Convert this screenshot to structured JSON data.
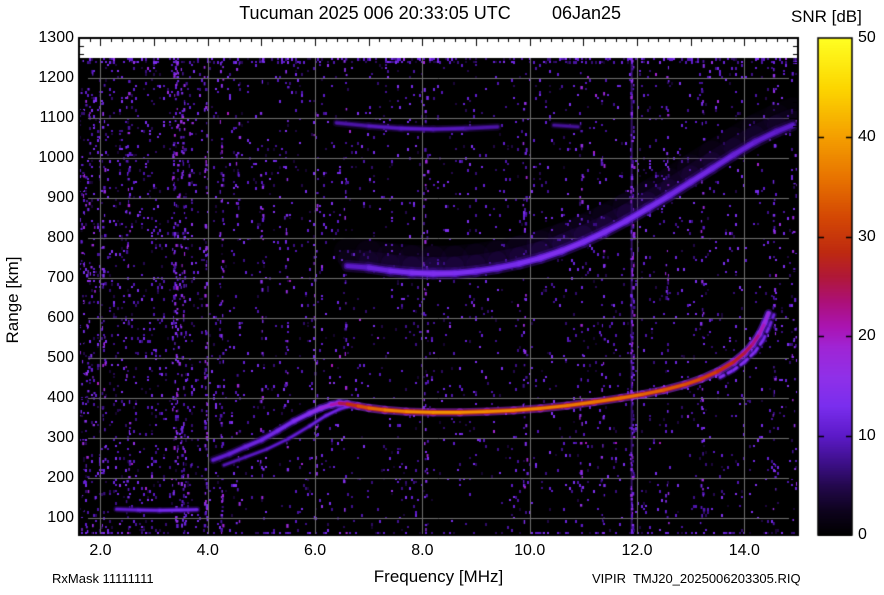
{
  "header": {
    "title": "Tucuman 2025 006 20:33:05 UTC",
    "date": "06Jan25"
  },
  "footer": {
    "left": "RxMask 11111111",
    "right": "VIPIR  TMJ20_2025006203305.RIQ"
  },
  "colorbar": {
    "title": "SNR [dB]",
    "min": 0,
    "max": 50,
    "tick_values": [
      0,
      10,
      20,
      30,
      40,
      50
    ],
    "tick_labels": [
      "0",
      "10",
      "20",
      "30",
      "40",
      "50"
    ]
  },
  "chart_data": {
    "type": "heatmap",
    "title": "Tucuman 2025 006 20:33:05 UTC 06Jan25",
    "xlabel": "Frequency [MHz]",
    "ylabel": "Range [km]",
    "zlabel": "SNR [dB]",
    "xlim": [
      1.6,
      15.0
    ],
    "ylim": [
      57.5,
      1300
    ],
    "zlim": [
      0,
      50
    ],
    "grid": true,
    "grid_color": "#6f6f6f",
    "x_major_ticks": [
      2,
      4,
      6,
      8,
      10,
      12,
      14
    ],
    "x_tick_labels": [
      "2.0",
      "4.0",
      "6.0",
      "8.0",
      "10.0",
      "12.0",
      "14.0"
    ],
    "x_minor_step": 0.2,
    "y_major_ticks": [
      100,
      200,
      300,
      400,
      500,
      600,
      700,
      800,
      900,
      1000,
      1100,
      1200,
      1300
    ],
    "y_minor_step": 20,
    "data_region_range_km": [
      60,
      1250
    ],
    "background_color": "#000000",
    "colormap_stops": [
      [
        0.0,
        [
          0,
          0,
          0
        ]
      ],
      [
        0.05,
        [
          14,
          3,
          30
        ]
      ],
      [
        0.1,
        [
          36,
          8,
          78
        ]
      ],
      [
        0.14,
        [
          58,
          14,
          130
        ]
      ],
      [
        0.2,
        [
          92,
          26,
          200
        ]
      ],
      [
        0.26,
        [
          122,
          46,
          238
        ]
      ],
      [
        0.32,
        [
          144,
          48,
          232
        ]
      ],
      [
        0.38,
        [
          160,
          36,
          212
        ]
      ],
      [
        0.42,
        [
          170,
          20,
          178
        ]
      ],
      [
        0.47,
        [
          172,
          16,
          120
        ]
      ],
      [
        0.52,
        [
          176,
          24,
          56
        ]
      ],
      [
        0.57,
        [
          190,
          42,
          16
        ]
      ],
      [
        0.64,
        [
          212,
          72,
          4
        ]
      ],
      [
        0.72,
        [
          232,
          116,
          0
        ]
      ],
      [
        0.8,
        [
          244,
          158,
          0
        ]
      ],
      [
        0.9,
        [
          252,
          214,
          0
        ]
      ],
      [
        1.0,
        [
          255,
          255,
          34
        ]
      ]
    ],
    "traces": {
      "f2_o_mode": {
        "label": "F2 first-hop O-mode echo",
        "base_width": 3.2,
        "points": [
          [
            4.1,
            245,
            10
          ],
          [
            4.4,
            260,
            11
          ],
          [
            4.7,
            278,
            11
          ],
          [
            5.0,
            295,
            12
          ],
          [
            5.3,
            318,
            12
          ],
          [
            5.6,
            342,
            13
          ],
          [
            5.9,
            362,
            15
          ],
          [
            6.1,
            374,
            16
          ],
          [
            6.3,
            383,
            19
          ],
          [
            6.45,
            387,
            23
          ],
          [
            6.6,
            385,
            27
          ],
          [
            6.8,
            380,
            31
          ],
          [
            7.0,
            375,
            34
          ],
          [
            7.3,
            370,
            36
          ],
          [
            7.7,
            366,
            38
          ],
          [
            8.2,
            364,
            39
          ],
          [
            8.7,
            364,
            39
          ],
          [
            9.2,
            366,
            38
          ],
          [
            9.7,
            369,
            38
          ],
          [
            10.2,
            374,
            37
          ],
          [
            10.7,
            381,
            37
          ],
          [
            11.2,
            390,
            36
          ],
          [
            11.7,
            400,
            36
          ],
          [
            12.1,
            409,
            35
          ],
          [
            12.5,
            420,
            34
          ],
          [
            12.9,
            434,
            33
          ],
          [
            13.2,
            448,
            32
          ],
          [
            13.5,
            466,
            30
          ],
          [
            13.8,
            490,
            28
          ],
          [
            14.0,
            512,
            26
          ],
          [
            14.15,
            534,
            24
          ],
          [
            14.28,
            560,
            22
          ],
          [
            14.38,
            588,
            19
          ],
          [
            14.45,
            612,
            16
          ]
        ]
      },
      "f2_x_mode_rise": {
        "label": "F2 X-mode rising branch",
        "base_width": 2.2,
        "points": [
          [
            4.3,
            232,
            9
          ],
          [
            4.7,
            252,
            9
          ],
          [
            5.1,
            272,
            10
          ],
          [
            5.5,
            298,
            10
          ],
          [
            5.9,
            330,
            11
          ],
          [
            6.2,
            356,
            12
          ],
          [
            6.45,
            372,
            12
          ],
          [
            6.6,
            378,
            11
          ]
        ]
      },
      "f2_x_mode_tail": {
        "label": "F2 X-mode cusp",
        "base_width": 2.4,
        "dashed": true,
        "points": [
          [
            13.55,
            452,
            14
          ],
          [
            13.8,
            470,
            14
          ],
          [
            14.0,
            490,
            14
          ],
          [
            14.2,
            516,
            14
          ],
          [
            14.35,
            545,
            13
          ],
          [
            14.47,
            580,
            12
          ],
          [
            14.55,
            608,
            11
          ]
        ]
      },
      "second_hop": {
        "label": "Second-hop / spread F echo",
        "base_width": 4.6,
        "haze": true,
        "points": [
          [
            6.6,
            730,
            9
          ],
          [
            7.0,
            726,
            11
          ],
          [
            7.4,
            718,
            12
          ],
          [
            7.8,
            713,
            13
          ],
          [
            8.2,
            711,
            14
          ],
          [
            8.6,
            712,
            13
          ],
          [
            9.0,
            717,
            13
          ],
          [
            9.4,
            725,
            12
          ],
          [
            9.8,
            736,
            13
          ],
          [
            10.2,
            750,
            13
          ],
          [
            10.6,
            768,
            14
          ],
          [
            11.0,
            790,
            13
          ],
          [
            11.4,
            815,
            13
          ],
          [
            11.8,
            843,
            13
          ],
          [
            12.2,
            874,
            13
          ],
          [
            12.6,
            906,
            12
          ],
          [
            13.0,
            940,
            12
          ],
          [
            13.4,
            974,
            12
          ],
          [
            13.8,
            1008,
            11
          ],
          [
            14.2,
            1040,
            11
          ],
          [
            14.6,
            1066,
            10
          ],
          [
            14.9,
            1082,
            10
          ]
        ]
      },
      "upper_arc": {
        "label": "Faint multi-hop arc",
        "base_width": 3.0,
        "points": [
          [
            6.4,
            1088,
            8
          ],
          [
            7.0,
            1080,
            9
          ],
          [
            7.6,
            1074,
            10
          ],
          [
            8.2,
            1072,
            10
          ],
          [
            8.8,
            1074,
            9
          ],
          [
            9.4,
            1078,
            8
          ]
        ]
      },
      "upper_arc2": {
        "label": "Faint multi-hop arc segment",
        "base_width": 2.6,
        "points": [
          [
            10.45,
            1082,
            8
          ],
          [
            10.9,
            1078,
            8
          ]
        ]
      },
      "e_region": {
        "label": "E-region echo",
        "base_width": 2.5,
        "points": [
          [
            2.3,
            122,
            10
          ],
          [
            2.7,
            120,
            11
          ],
          [
            3.1,
            119,
            12
          ],
          [
            3.5,
            120,
            13
          ],
          [
            3.8,
            121,
            11
          ]
        ]
      }
    },
    "rfi_stripes": [
      {
        "f": 1.73,
        "strength": 0.7,
        "width_mhz": 0.34
      },
      {
        "f": 2.05,
        "strength": 0.3,
        "width_mhz": 0.06
      },
      {
        "f": 2.5,
        "strength": 0.4,
        "width_mhz": 0.08
      },
      {
        "f": 3.38,
        "strength": 0.75,
        "width_mhz": 0.1
      },
      {
        "f": 3.52,
        "strength": 0.65,
        "width_mhz": 0.08
      },
      {
        "f": 3.5,
        "strength": 0.3,
        "width_mhz": 0.4
      },
      {
        "f": 3.95,
        "strength": 0.5,
        "width_mhz": 0.06
      },
      {
        "f": 4.25,
        "strength": 0.45,
        "width_mhz": 0.06
      },
      {
        "f": 4.55,
        "strength": 0.25,
        "width_mhz": 0.06
      },
      {
        "f": 5.0,
        "strength": 0.28,
        "width_mhz": 0.06
      },
      {
        "f": 5.45,
        "strength": 0.22,
        "width_mhz": 0.06
      },
      {
        "f": 6.0,
        "strength": 0.28,
        "width_mhz": 0.06
      },
      {
        "f": 6.55,
        "strength": 0.22,
        "width_mhz": 0.06
      },
      {
        "f": 8.05,
        "strength": 0.42,
        "width_mhz": 0.08
      },
      {
        "f": 9.9,
        "strength": 0.38,
        "width_mhz": 0.08
      },
      {
        "f": 10.95,
        "strength": 0.28,
        "width_mhz": 0.06
      },
      {
        "f": 11.35,
        "strength": 0.2,
        "width_mhz": 0.06
      },
      {
        "f": 11.9,
        "strength": 0.9,
        "width_mhz": 0.06,
        "solid": true
      },
      {
        "f": 12.55,
        "strength": 0.22,
        "width_mhz": 0.06
      },
      {
        "f": 13.2,
        "strength": 0.38,
        "width_mhz": 0.06
      },
      {
        "f": 14.55,
        "strength": 0.26,
        "width_mhz": 0.06
      },
      {
        "f": 14.93,
        "strength": 0.32,
        "width_mhz": 0.1
      }
    ],
    "noise": {
      "base_density": 0.045,
      "low_freq_density": 0.105,
      "low_freq_limit_mhz": 4.6,
      "dense_edge_rows_km": [
        1245,
        62
      ],
      "snr_range_db": [
        3,
        14
      ]
    }
  }
}
